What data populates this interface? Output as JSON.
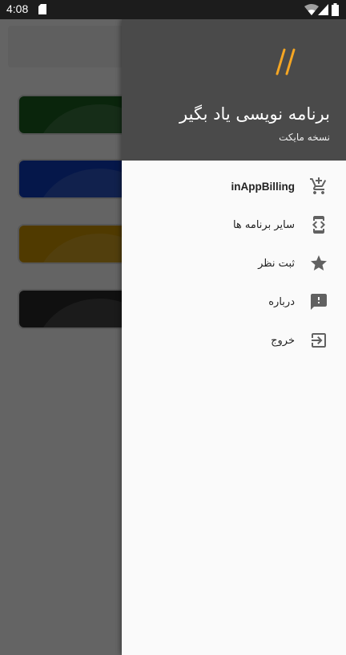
{
  "status_bar": {
    "time": "4:08"
  },
  "drawer": {
    "title": "برنامه نویسی یاد بگیر",
    "subtitle": "نسخه مایکت",
    "logo_color": "#f5a623",
    "header_color": "#4a4a4a",
    "items": [
      {
        "label": "inAppBilling",
        "icon": "add-shopping-cart-icon"
      },
      {
        "label": "سایر برنامه ها",
        "icon": "developer-mode-icon"
      },
      {
        "label": "ثبت نظر",
        "icon": "star-icon"
      },
      {
        "label": "درباره",
        "icon": "feedback-icon"
      },
      {
        "label": "خروج",
        "icon": "exit-icon"
      }
    ]
  },
  "background": {
    "card_colors": [
      "#1b5e20",
      "#0d3ab8",
      "#c79100",
      "#2a2a2a"
    ]
  }
}
